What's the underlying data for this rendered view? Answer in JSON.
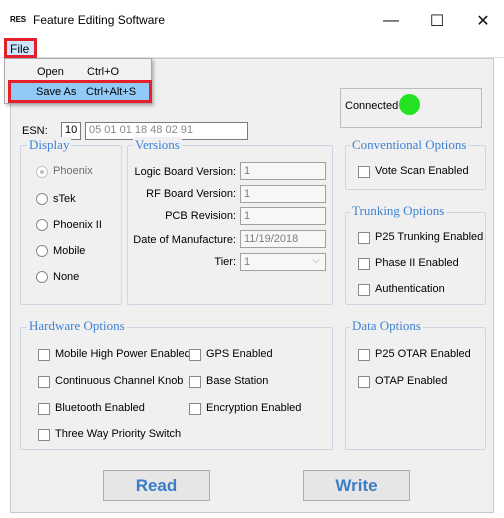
{
  "window": {
    "logo_text": "RES",
    "title": "Feature Editing Software",
    "minimize_glyph": "—",
    "maximize_glyph": "☐",
    "close_glyph": "✕"
  },
  "menu": {
    "file_label": "File",
    "items": [
      {
        "label": "Open",
        "shortcut": "Ctrl+O"
      },
      {
        "label": "Save As",
        "shortcut": "Ctrl+Alt+S"
      }
    ]
  },
  "esn": {
    "label": "ESN:",
    "prefix": "10",
    "value": "05 01 01 18 48 02 91"
  },
  "connection": {
    "label": "Connected",
    "status_color": "#22e222"
  },
  "display": {
    "title": "Display",
    "options": [
      {
        "label": "Phoenix",
        "checked": true
      },
      {
        "label": "sTek",
        "checked": false
      },
      {
        "label": "Phoenix II",
        "checked": false
      },
      {
        "label": "Mobile",
        "checked": false
      },
      {
        "label": "None",
        "checked": false
      }
    ]
  },
  "versions": {
    "title": "Versions",
    "fields": [
      {
        "label": "Logic Board Version:",
        "value": "1"
      },
      {
        "label": "RF Board Version:",
        "value": "1"
      },
      {
        "label": "PCB Revision:",
        "value": "1"
      },
      {
        "label": "Date of Manufacture:",
        "value": "11/19/2018"
      },
      {
        "label": "Tier:",
        "value": "1"
      }
    ]
  },
  "conventional": {
    "title": "Conventional Options",
    "options": [
      "Vote Scan Enabled"
    ]
  },
  "trunking": {
    "title": "Trunking Options",
    "options": [
      "P25 Trunking Enabled",
      "Phase II Enabled",
      "Authentication"
    ]
  },
  "hardware": {
    "title": "Hardware Options",
    "left": [
      "Mobile High Power Enabled",
      "Continuous Channel Knob",
      "Bluetooth Enabled",
      "Three Way Priority Switch"
    ],
    "right": [
      "GPS Enabled",
      "Base Station",
      "Encryption Enabled"
    ]
  },
  "data_options": {
    "title": "Data Options",
    "options": [
      "P25 OTAR Enabled",
      "OTAP Enabled"
    ]
  },
  "buttons": {
    "read": "Read",
    "write": "Write"
  },
  "colors": {
    "accent": "#3d82d4",
    "highlight_border": "#e5202b"
  }
}
